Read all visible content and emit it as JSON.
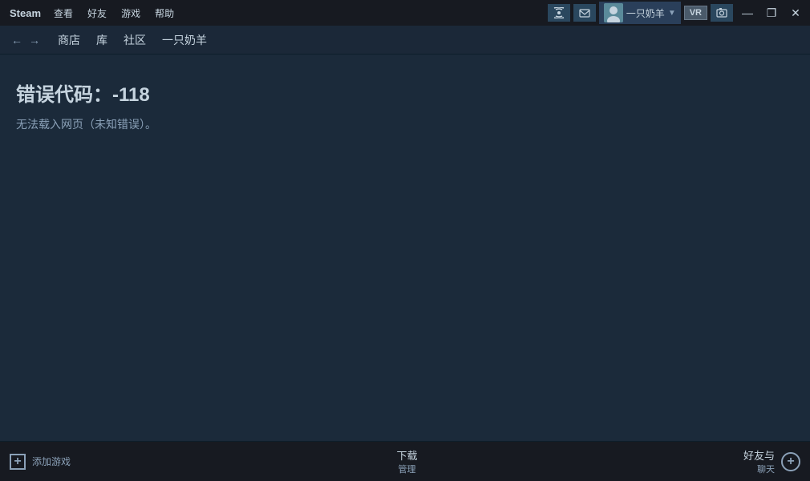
{
  "titlebar": {
    "app_title": "Steam",
    "menus": [
      "查看",
      "好友",
      "游戏",
      "帮助"
    ],
    "username": "一只奶羊",
    "vr_label": "VR",
    "minimize": "—",
    "restore": "❐",
    "close": "✕"
  },
  "navbar": {
    "back_arrow": "←",
    "forward_arrow": "→",
    "links": [
      "商店",
      "库",
      "社区",
      "一只奶羊"
    ]
  },
  "main": {
    "error_title": "错误代码：-118",
    "error_desc": "无法载入网页（未知错误）。"
  },
  "bottombar": {
    "add_game_label": "添加游戏",
    "download_label": "下载",
    "manage_label": "管理",
    "friends_label": "好友与",
    "chat_label": "聊天"
  }
}
